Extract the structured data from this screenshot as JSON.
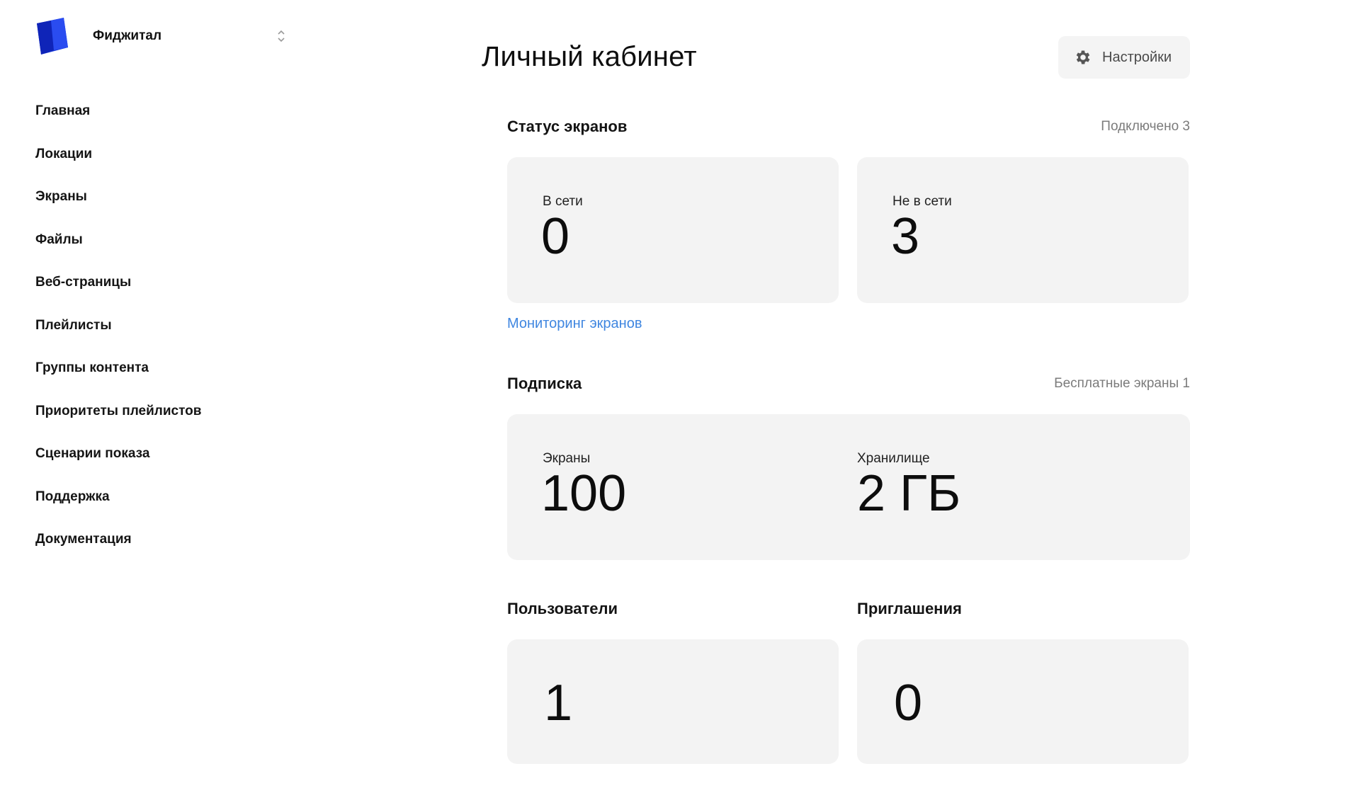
{
  "sidebar": {
    "org_name": "Фиджитал",
    "nav_items": [
      {
        "label": "Главная"
      },
      {
        "label": "Локации"
      },
      {
        "label": "Экраны"
      },
      {
        "label": "Файлы"
      },
      {
        "label": "Веб-страницы"
      },
      {
        "label": "Плейлисты"
      },
      {
        "label": "Группы контента"
      },
      {
        "label": "Приоритеты плейлистов"
      },
      {
        "label": "Сценарии показа"
      },
      {
        "label": "Поддержка"
      },
      {
        "label": "Документация"
      }
    ]
  },
  "header": {
    "title": "Личный кабинет",
    "settings_label": "Настройки"
  },
  "screens_status": {
    "title": "Статус экранов",
    "meta": "Подключено 3",
    "online_label": "В сети",
    "online_value": "0",
    "offline_label": "Не в сети",
    "offline_value": "3",
    "monitoring_link": "Мониторинг экранов"
  },
  "subscription": {
    "title": "Подписка",
    "meta": "Бесплатные экраны 1",
    "screens_label": "Экраны",
    "screens_value": "100",
    "storage_label": "Хранилище",
    "storage_value": "2 ГБ"
  },
  "users": {
    "title": "Пользователи",
    "value": "1"
  },
  "invites": {
    "title": "Приглашения",
    "value": "0"
  },
  "colors": {
    "accent_link": "#3f86e0",
    "logo_primary": "#1a2fe0",
    "card_bg": "#f3f3f3"
  }
}
